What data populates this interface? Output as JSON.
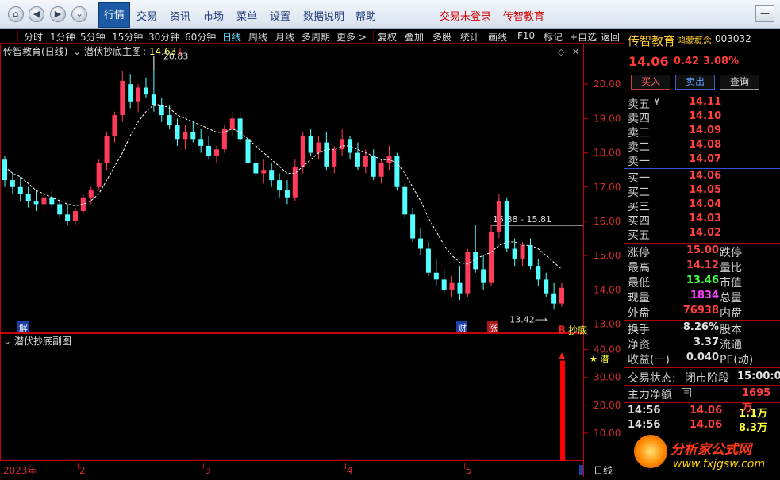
{
  "menubar": {
    "items": [
      "行情",
      "交易",
      "资讯",
      "市场",
      "菜单",
      "设置",
      "数据说明",
      "帮助"
    ],
    "login_status": "交易未登录",
    "app_name": "传智教育",
    "back_glyph": "◀",
    "forward_glyph": "▶",
    "home_glyph": "⌂",
    "down_glyph": "⌄",
    "win_min": "—",
    "win_close": "✕"
  },
  "toolbar": {
    "periods": [
      "分时",
      "1分钟",
      "5分钟",
      "15分钟",
      "30分钟",
      "60分钟",
      "日线",
      "周线",
      "月线",
      "多周期",
      "更多 >"
    ],
    "selected_period": "日线",
    "actions": [
      "复权",
      "叠加",
      "多股",
      "统计",
      "画线",
      "F10",
      "标记",
      "+自选",
      "返回"
    ]
  },
  "chart": {
    "stock_label": "传智教育(日线)",
    "indicator_main": "潜伏抄底主图",
    "indicator_value": ": 14.63",
    "indicator_arrow": "↓",
    "indicator_sub": "潜伏抄底副图",
    "high_label": "20.83",
    "low_label": "13.42",
    "range_label": "15.88 - 15.81",
    "buy_signal": "B",
    "buy_text": "抄底",
    "sub_signal_text": "★ 潜",
    "markers": {
      "jie": "解",
      "cai": "财",
      "zhang": "涨"
    },
    "x_labels": [
      "2023年",
      "2",
      "3",
      "4",
      "5"
    ],
    "period_tag": "日线",
    "colors": {
      "up": "#ff3b5c",
      "down": "#54ffff",
      "ma": "#ffffff",
      "axis": "#c8000a",
      "volume_bar": "#ff0000"
    }
  },
  "chart_data": {
    "type": "candlestick",
    "main_yaxis_ticks": [
      "20.00",
      "19.00",
      "18.00",
      "17.00",
      "16.00",
      "15.00",
      "14.00",
      "13.00"
    ],
    "main_ylim": [
      12.85,
      21.0
    ],
    "sub_yaxis_ticks": [
      "40.00",
      "30.00",
      "20.00",
      "10.00"
    ],
    "sub_ylim": [
      0,
      45
    ],
    "ohlc": [
      [
        17.8,
        17.9,
        17.0,
        17.2
      ],
      [
        17.2,
        17.4,
        16.8,
        17.0
      ],
      [
        17.0,
        17.3,
        16.6,
        16.8
      ],
      [
        16.8,
        17.0,
        16.4,
        16.6
      ],
      [
        16.6,
        16.9,
        16.3,
        16.5
      ],
      [
        16.5,
        16.8,
        16.3,
        16.7
      ],
      [
        16.7,
        16.9,
        16.4,
        16.5
      ],
      [
        16.5,
        16.6,
        16.1,
        16.2
      ],
      [
        16.2,
        16.5,
        15.9,
        16.0
      ],
      [
        16.0,
        16.4,
        15.9,
        16.3
      ],
      [
        16.3,
        16.8,
        16.2,
        16.7
      ],
      [
        16.7,
        17.0,
        16.5,
        16.9
      ],
      [
        17.0,
        17.8,
        16.9,
        17.7
      ],
      [
        17.7,
        18.6,
        17.5,
        18.5
      ],
      [
        18.5,
        19.2,
        18.3,
        19.1
      ],
      [
        19.1,
        20.4,
        18.9,
        20.1
      ],
      [
        20.0,
        20.3,
        19.3,
        19.5
      ],
      [
        19.5,
        20.0,
        19.2,
        19.9
      ],
      [
        19.9,
        20.2,
        19.6,
        19.7
      ],
      [
        19.7,
        20.83,
        19.2,
        19.4
      ],
      [
        19.4,
        19.6,
        18.9,
        19.1
      ],
      [
        19.1,
        19.4,
        18.7,
        18.8
      ],
      [
        18.8,
        19.0,
        18.2,
        18.4
      ],
      [
        18.4,
        18.8,
        18.1,
        18.6
      ],
      [
        18.6,
        18.9,
        18.3,
        18.4
      ],
      [
        18.4,
        18.7,
        18.0,
        18.2
      ],
      [
        18.2,
        18.5,
        17.8,
        17.9
      ],
      [
        17.9,
        18.2,
        17.7,
        18.1
      ],
      [
        18.1,
        18.8,
        18.0,
        18.7
      ],
      [
        18.7,
        19.2,
        18.5,
        19.0
      ],
      [
        19.0,
        19.2,
        18.3,
        18.4
      ],
      [
        18.4,
        18.6,
        17.6,
        17.7
      ],
      [
        17.7,
        18.0,
        17.3,
        17.4
      ],
      [
        17.4,
        17.8,
        17.1,
        17.5
      ],
      [
        17.5,
        17.7,
        17.0,
        17.2
      ],
      [
        17.2,
        17.4,
        16.7,
        16.9
      ],
      [
        16.9,
        17.2,
        16.5,
        16.7
      ],
      [
        16.7,
        17.8,
        16.6,
        17.6
      ],
      [
        17.6,
        18.6,
        17.4,
        18.5
      ],
      [
        18.5,
        18.7,
        17.9,
        18.0
      ],
      [
        18.0,
        18.5,
        17.8,
        18.3
      ],
      [
        18.3,
        18.6,
        17.5,
        17.6
      ],
      [
        17.6,
        18.2,
        17.4,
        18.1
      ],
      [
        18.1,
        18.7,
        17.9,
        18.4
      ],
      [
        18.4,
        18.5,
        17.8,
        18.0
      ],
      [
        18.0,
        18.3,
        17.5,
        17.6
      ],
      [
        17.6,
        18.1,
        17.4,
        17.9
      ],
      [
        17.9,
        18.1,
        17.2,
        17.3
      ],
      [
        17.3,
        17.8,
        17.1,
        17.7
      ],
      [
        17.7,
        18.2,
        17.5,
        17.9
      ],
      [
        17.9,
        18.0,
        16.9,
        17.0
      ],
      [
        17.0,
        17.1,
        16.1,
        16.2
      ],
      [
        16.2,
        16.4,
        15.4,
        15.5
      ],
      [
        15.5,
        15.8,
        15.0,
        15.2
      ],
      [
        15.2,
        15.4,
        14.4,
        14.5
      ],
      [
        14.5,
        14.9,
        14.1,
        14.3
      ],
      [
        14.3,
        14.6,
        13.9,
        14.0
      ],
      [
        14.0,
        14.4,
        13.8,
        14.2
      ],
      [
        14.2,
        14.7,
        13.7,
        13.9
      ],
      [
        13.9,
        15.2,
        13.8,
        15.1
      ],
      [
        15.1,
        15.9,
        14.5,
        14.6
      ],
      [
        14.6,
        15.0,
        14.0,
        14.2
      ],
      [
        14.2,
        15.9,
        14.1,
        15.7
      ],
      [
        15.7,
        16.8,
        15.5,
        16.6
      ],
      [
        16.6,
        16.7,
        15.1,
        15.2
      ],
      [
        15.2,
        15.5,
        14.7,
        14.9
      ],
      [
        14.9,
        15.4,
        14.7,
        15.3
      ],
      [
        15.3,
        15.5,
        14.6,
        14.7
      ],
      [
        14.7,
        14.9,
        14.1,
        14.3
      ],
      [
        14.3,
        14.5,
        13.8,
        13.9
      ],
      [
        13.9,
        14.2,
        13.42,
        13.6
      ],
      [
        13.6,
        14.2,
        13.5,
        14.06
      ]
    ],
    "ma_line": [
      17.6,
      17.4,
      17.3,
      17.1,
      16.9,
      16.8,
      16.7,
      16.6,
      16.5,
      16.45,
      16.5,
      16.6,
      16.8,
      17.2,
      17.6,
      18.0,
      18.5,
      18.9,
      19.2,
      19.4,
      19.4,
      19.3,
      19.1,
      19.0,
      18.9,
      18.8,
      18.7,
      18.6,
      18.6,
      18.7,
      18.6,
      18.4,
      18.2,
      18.0,
      17.8,
      17.6,
      17.4,
      17.4,
      17.6,
      17.8,
      18.0,
      18.1,
      18.1,
      18.2,
      18.2,
      18.1,
      18.0,
      17.9,
      17.8,
      17.8,
      17.7,
      17.4,
      17.0,
      16.6,
      16.1,
      15.7,
      15.3,
      15.0,
      14.8,
      14.75,
      14.9,
      15.0,
      15.1,
      15.3,
      15.4,
      15.4,
      15.3,
      15.3,
      15.2,
      15.0,
      14.8,
      14.6
    ],
    "sub_bar_value": 36
  },
  "right_panel": {
    "title": "传智教育",
    "concept": "鸿蒙概念",
    "code": "003032",
    "price": "14.06",
    "change": "0.42",
    "change_pct": "3.08%",
    "buttons": [
      "买入",
      "卖出",
      "查询"
    ],
    "sell_orders": [
      {
        "label": "卖五",
        "price": "14.11"
      },
      {
        "label": "卖四",
        "price": "14.10"
      },
      {
        "label": "卖三",
        "price": "14.09"
      },
      {
        "label": "卖二",
        "price": "14.08"
      },
      {
        "label": "卖一",
        "price": "14.07"
      }
    ],
    "buy_orders": [
      {
        "label": "买一",
        "price": "14.06"
      },
      {
        "label": "买二",
        "price": "14.05"
      },
      {
        "label": "买三",
        "price": "14.04"
      },
      {
        "label": "买四",
        "price": "14.03"
      },
      {
        "label": "买五",
        "price": "14.02"
      }
    ],
    "yen_mark": "¥",
    "stats": [
      {
        "k": "涨停",
        "v": "15.00",
        "color": "#ff4040",
        "k2": "跌停"
      },
      {
        "k": "最高",
        "v": "14.12",
        "color": "#ff4040",
        "k2": "量比"
      },
      {
        "k": "最低",
        "v": "13.46",
        "color": "#40ff40",
        "k2": "市值"
      },
      {
        "k": "现量",
        "v": "1834",
        "color": "#ff40ff",
        "k2": "总量"
      },
      {
        "k": "外盘",
        "v": "76938",
        "color": "#ff4040",
        "k2": "内盘"
      }
    ],
    "stats2": [
      {
        "k": "换手",
        "v": "8.26%",
        "color": "#e0e0e0",
        "k2": "股本"
      },
      {
        "k": "净资",
        "v": "3.37",
        "color": "#e0e0e0",
        "k2": "流通"
      },
      {
        "k": "收益(一)",
        "v": "0.040",
        "color": "#e0e0e0",
        "k2": "PE(动)"
      }
    ],
    "trade_status_label": "交易状态:",
    "trade_status": "闭市阶段",
    "trade_time": "15:00:0",
    "main_flow_label": "主力净额",
    "main_flow_value": "1695万",
    "ticks": [
      {
        "time": "14:56",
        "price": "14.06",
        "vol": "1.1万"
      },
      {
        "time": "14:56",
        "price": "14.06",
        "vol": "8.3万"
      }
    ]
  },
  "watermark": {
    "line1": "分析家公式网",
    "line2": "www.fxjgsw.com"
  }
}
